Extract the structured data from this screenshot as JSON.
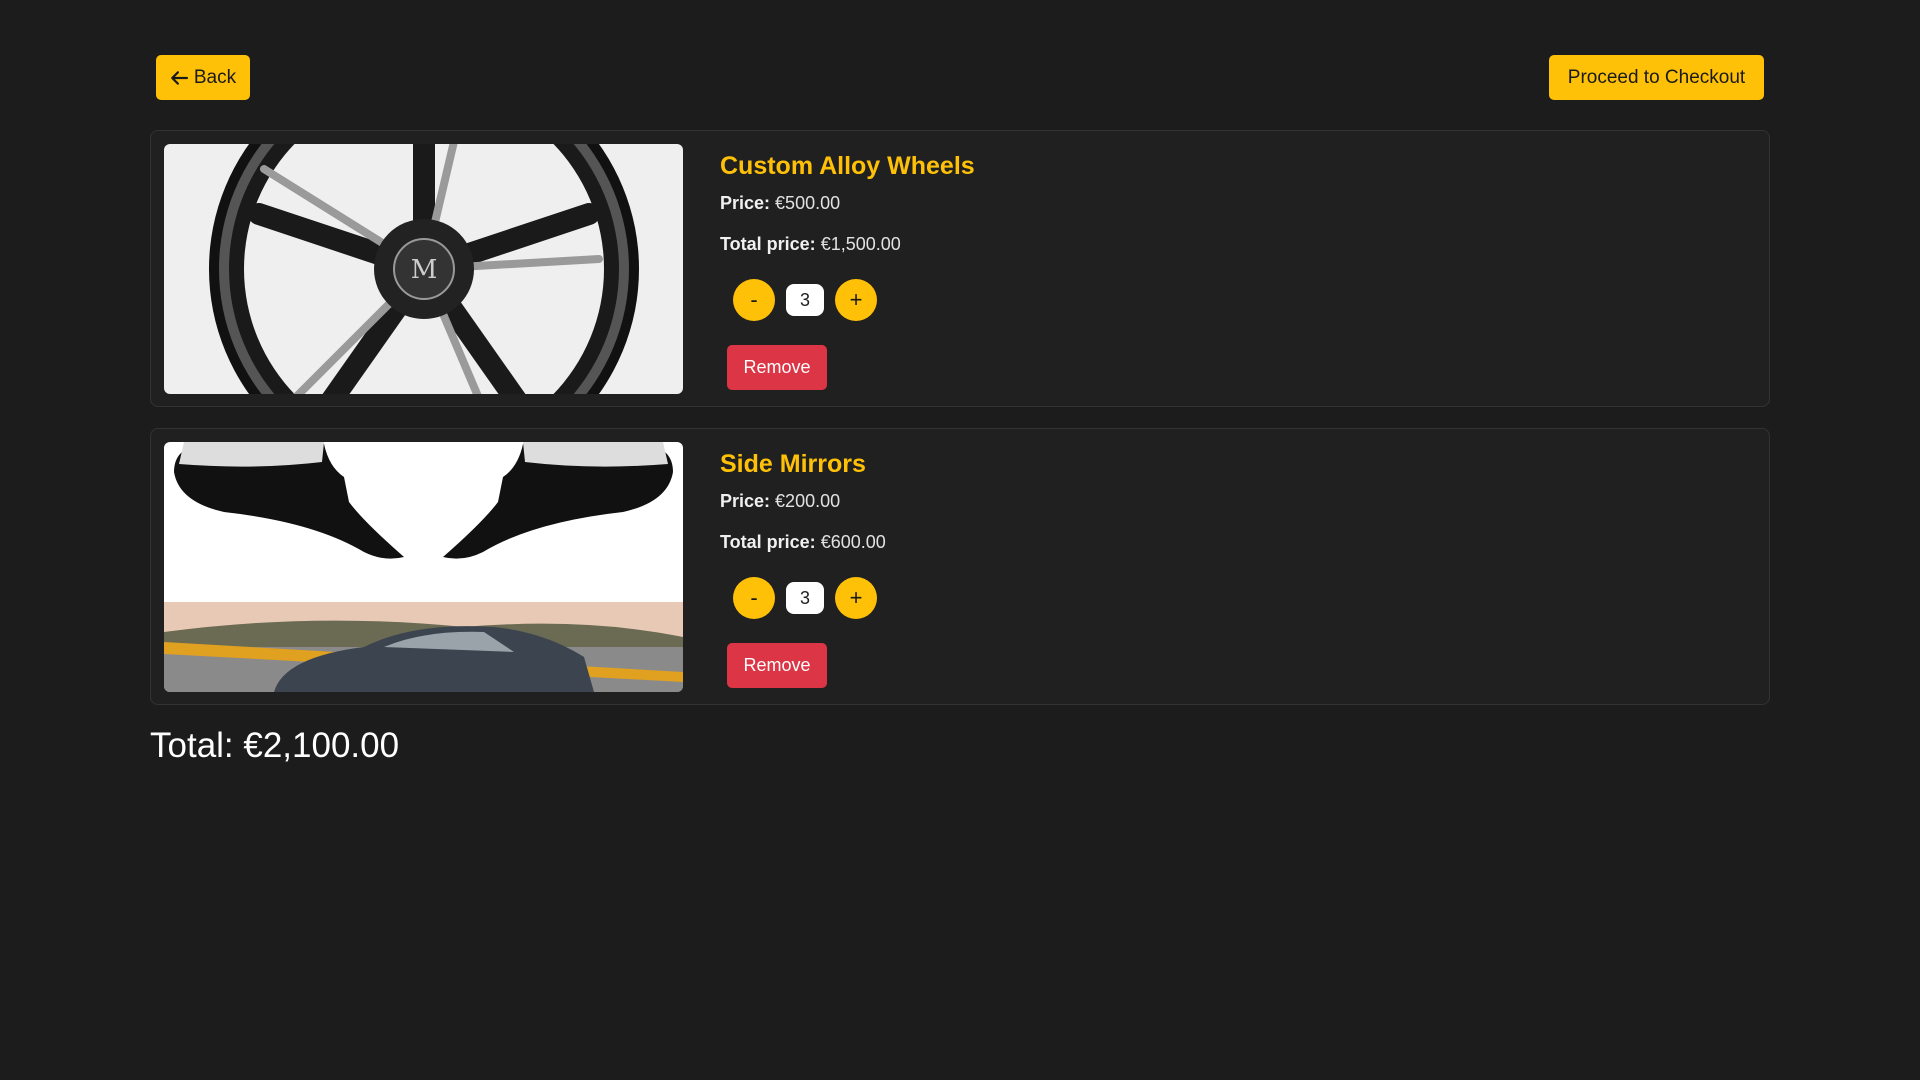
{
  "header": {
    "back_label": "Back",
    "checkout_label": "Proceed to Checkout"
  },
  "colors": {
    "accent": "#ffc107",
    "danger": "#dc3545",
    "background": "#1c1c1c",
    "card": "#202020"
  },
  "cart": {
    "items": [
      {
        "name": "Custom Alloy Wheels",
        "price_label": "Price:",
        "price": "€500.00",
        "total_label": "Total price:",
        "total": "€1,500.00",
        "quantity": "3",
        "minus": "-",
        "plus": "+",
        "remove": "Remove",
        "image": "alloy-wheel-image"
      },
      {
        "name": "Side Mirrors",
        "price_label": "Price:",
        "price": "€200.00",
        "total_label": "Total price:",
        "total": "€600.00",
        "quantity": "3",
        "minus": "-",
        "plus": "+",
        "remove": "Remove",
        "image": "side-mirrors-image"
      }
    ],
    "grand_total": "Total: €2,100.00"
  }
}
